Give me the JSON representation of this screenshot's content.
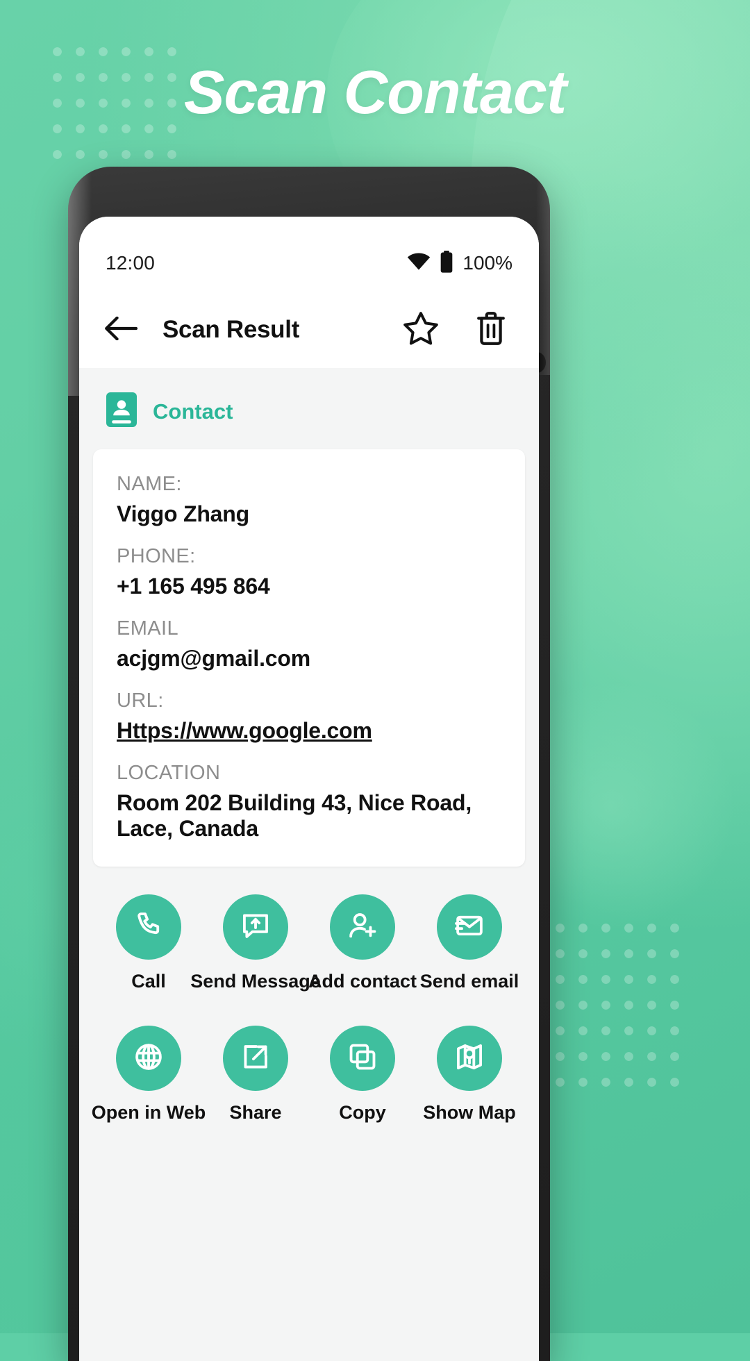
{
  "promo": {
    "headline": "Scan Contact",
    "accent_color": "#3fbf9e",
    "background_color": "#5ecfa6"
  },
  "status_bar": {
    "time": "12:00",
    "battery_percent": "100%",
    "wifi_icon": "wifi-icon",
    "battery_icon": "battery-full-icon"
  },
  "app_bar": {
    "back_icon": "arrow-left-icon",
    "title": "Scan Result",
    "favorite_icon": "star-outline-icon",
    "delete_icon": "trash-icon"
  },
  "result": {
    "type_icon": "contact-card-icon",
    "type_label": "Contact",
    "fields": [
      {
        "label": "NAME:",
        "value": "Viggo Zhang",
        "link": false
      },
      {
        "label": "PHONE:",
        "value": "+1 165 495 864",
        "link": false
      },
      {
        "label": "EMAIL",
        "value": "acjgm@gmail.com",
        "link": false
      },
      {
        "label": "URL:",
        "value": "Https://www.google.com",
        "link": true
      },
      {
        "label": "LOCATION",
        "value": "Room 202 Building 43, Nice Road, Lace, Canada",
        "link": false
      }
    ]
  },
  "actions": {
    "row1": [
      {
        "label": "Call",
        "icon": "phone-icon"
      },
      {
        "label": "Send Message",
        "icon": "message-upload-icon"
      },
      {
        "label": "Add contact",
        "icon": "person-add-icon"
      },
      {
        "label": "Send email",
        "icon": "envelope-arrow-icon"
      }
    ],
    "row2": [
      {
        "label": "Open in Web",
        "icon": "globe-icon"
      },
      {
        "label": "Share",
        "icon": "share-external-icon"
      },
      {
        "label": "Copy",
        "icon": "copy-icon"
      },
      {
        "label": "Show Map",
        "icon": "map-pin-icon"
      }
    ]
  }
}
